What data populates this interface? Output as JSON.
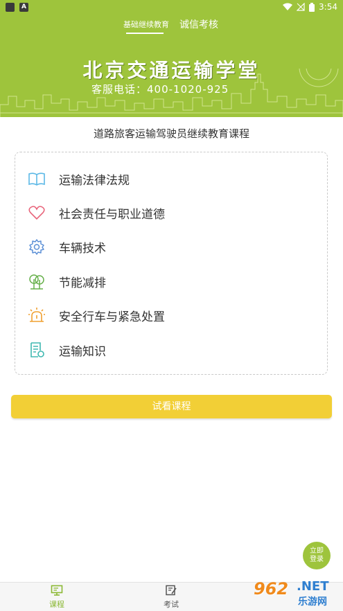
{
  "status_bar": {
    "time": "3:54",
    "indicator_letter": "A"
  },
  "header": {
    "tabs": [
      {
        "label": "基础继续教育",
        "active": true
      },
      {
        "label": "诚信考核",
        "active": false
      }
    ],
    "banner_title": "北京交通运输学堂",
    "banner_phone": "客服电话：400-1020-925",
    "background_color": "#9ec43c"
  },
  "subtitle": "道路旅客运输驾驶员继续教育课程",
  "courses": [
    {
      "label": "运输法律法规",
      "icon": "book-icon",
      "color": "#5bb8e6"
    },
    {
      "label": "社会责任与职业道德",
      "icon": "heart-icon",
      "color": "#e8647a"
    },
    {
      "label": "车辆技术",
      "icon": "gear-icon",
      "color": "#5b8fd6"
    },
    {
      "label": "节能减排",
      "icon": "tree-icon",
      "color": "#66b04a"
    },
    {
      "label": "安全行车与紧急处置",
      "icon": "alarm-light-icon",
      "color": "#f0a030"
    },
    {
      "label": "运输知识",
      "icon": "document-icon",
      "color": "#3fb8b0"
    }
  ],
  "try_button": {
    "label": "试看课程",
    "color": "#f2cf36"
  },
  "login_button": {
    "line1": "立即",
    "line2": "登录"
  },
  "bottom_nav": [
    {
      "label": "课程",
      "icon": "monitor-icon",
      "active": true,
      "color": "#8ab833"
    },
    {
      "label": "考试",
      "icon": "exam-icon",
      "active": false,
      "color": "#555555"
    }
  ],
  "watermark": {
    "number": "962",
    "domain": ".NET",
    "sub": "乐游网"
  }
}
